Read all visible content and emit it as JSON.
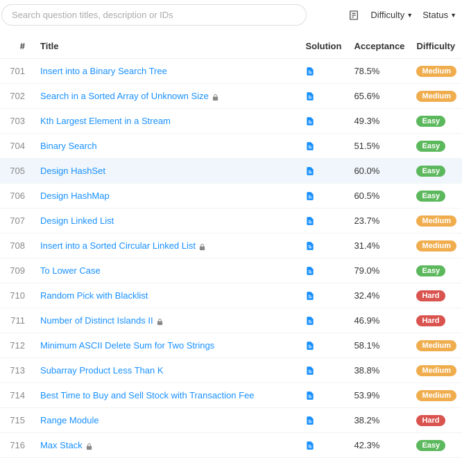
{
  "search": {
    "placeholder": "Search question titles, description or IDs"
  },
  "filters": {
    "difficulty": "Difficulty",
    "status": "Status"
  },
  "headers": {
    "num": "#",
    "title": "Title",
    "solution": "Solution",
    "acceptance": "Acceptance",
    "difficulty": "Difficulty"
  },
  "problems": [
    {
      "id": "701",
      "title": "Insert into a Binary Search Tree",
      "locked": false,
      "acceptance": "78.5%",
      "difficulty": "Medium"
    },
    {
      "id": "702",
      "title": "Search in a Sorted Array of Unknown Size",
      "locked": true,
      "acceptance": "65.6%",
      "difficulty": "Medium"
    },
    {
      "id": "703",
      "title": "Kth Largest Element in a Stream",
      "locked": false,
      "acceptance": "49.3%",
      "difficulty": "Easy"
    },
    {
      "id": "704",
      "title": "Binary Search",
      "locked": false,
      "acceptance": "51.5%",
      "difficulty": "Easy"
    },
    {
      "id": "705",
      "title": "Design HashSet",
      "locked": false,
      "acceptance": "60.0%",
      "difficulty": "Easy",
      "highlight": true
    },
    {
      "id": "706",
      "title": "Design HashMap",
      "locked": false,
      "acceptance": "60.5%",
      "difficulty": "Easy"
    },
    {
      "id": "707",
      "title": "Design Linked List",
      "locked": false,
      "acceptance": "23.7%",
      "difficulty": "Medium"
    },
    {
      "id": "708",
      "title": "Insert into a Sorted Circular Linked List",
      "locked": true,
      "acceptance": "31.4%",
      "difficulty": "Medium"
    },
    {
      "id": "709",
      "title": "To Lower Case",
      "locked": false,
      "acceptance": "79.0%",
      "difficulty": "Easy"
    },
    {
      "id": "710",
      "title": "Random Pick with Blacklist",
      "locked": false,
      "acceptance": "32.4%",
      "difficulty": "Hard"
    },
    {
      "id": "711",
      "title": "Number of Distinct Islands II",
      "locked": true,
      "acceptance": "46.9%",
      "difficulty": "Hard"
    },
    {
      "id": "712",
      "title": "Minimum ASCII Delete Sum for Two Strings",
      "locked": false,
      "acceptance": "58.1%",
      "difficulty": "Medium"
    },
    {
      "id": "713",
      "title": "Subarray Product Less Than K",
      "locked": false,
      "acceptance": "38.8%",
      "difficulty": "Medium"
    },
    {
      "id": "714",
      "title": "Best Time to Buy and Sell Stock with Transaction Fee",
      "locked": false,
      "acceptance": "53.9%",
      "difficulty": "Medium"
    },
    {
      "id": "715",
      "title": "Range Module",
      "locked": false,
      "acceptance": "38.2%",
      "difficulty": "Hard"
    },
    {
      "id": "716",
      "title": "Max Stack",
      "locked": true,
      "acceptance": "42.3%",
      "difficulty": "Easy"
    }
  ]
}
